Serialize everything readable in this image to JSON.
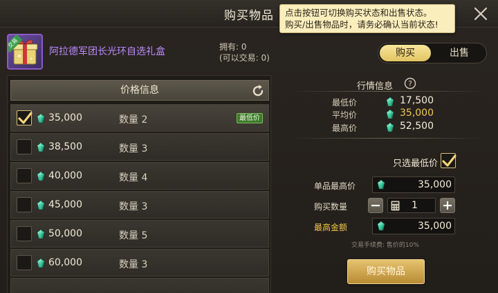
{
  "window": {
    "title": "购买物品"
  },
  "tooltip": {
    "line1": "点击按钮可切换购买状态和出售状态。",
    "line2": "购买/出售物品时，请务必确认当前状态!"
  },
  "item": {
    "name": "阿拉德军团长光环自选礼盒",
    "badge": "交易",
    "owned_label": "拥有: 0",
    "tradable_label": "(可以交易: 0)"
  },
  "mode_toggle": {
    "buy": "购买",
    "sell": "出售",
    "active": "buy"
  },
  "listings": {
    "header": "价格信息",
    "rows": [
      {
        "price": "35,000",
        "qty": "数量 2",
        "badge": "最低价",
        "selected": true
      },
      {
        "price": "38,500",
        "qty": "数量 3",
        "badge": "",
        "selected": false
      },
      {
        "price": "40,000",
        "qty": "数量 4",
        "badge": "",
        "selected": false
      },
      {
        "price": "45,000",
        "qty": "数量 3",
        "badge": "",
        "selected": false
      },
      {
        "price": "50,000",
        "qty": "数量 5",
        "badge": "",
        "selected": false
      },
      {
        "price": "60,000",
        "qty": "数量 3",
        "badge": "",
        "selected": false
      }
    ]
  },
  "market": {
    "title": "行情信息",
    "min_label": "最低价",
    "min_value": "17,500",
    "avg_label": "平均价",
    "avg_value": "35,000",
    "max_label": "最高价",
    "max_value": "52,500"
  },
  "purchase": {
    "only_lowest_label": "只选最低价",
    "only_lowest_checked": true,
    "unit_max_label": "单品最高价",
    "unit_max_value": "35,000",
    "qty_label": "购买数量",
    "qty_value": "1",
    "max_total_label": "最高金额",
    "max_total_value": "35,000",
    "fee_note": "交易手续费: 售价的10%",
    "buy_button": "购买物品"
  },
  "colors": {
    "accent_gold": "#f2c84a",
    "item_name_purple": "#b98aff",
    "lowest_badge_green": "#3f7a2c",
    "tooltip_bg": "#fbeebd"
  }
}
